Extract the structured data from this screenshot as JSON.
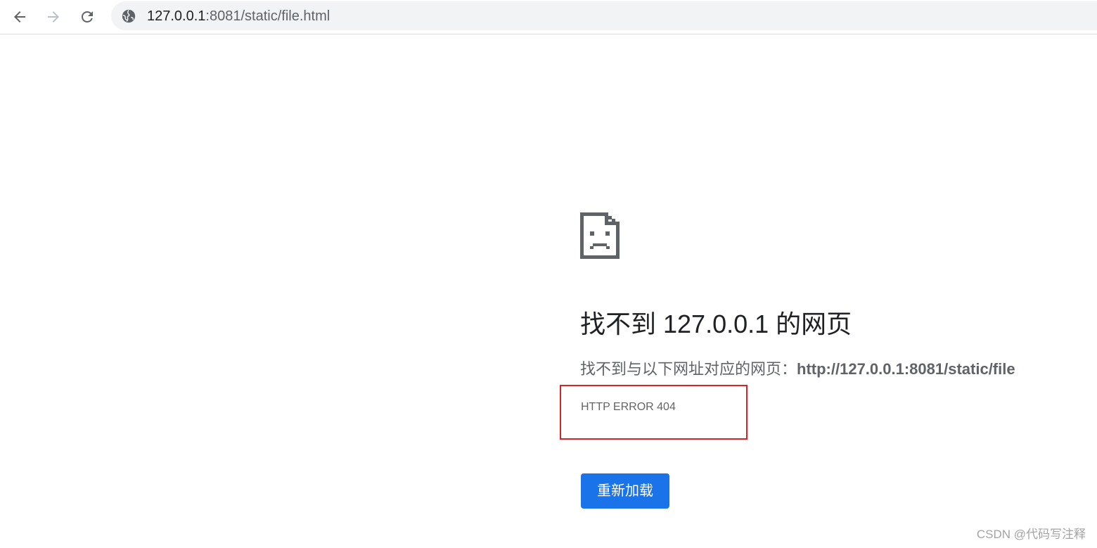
{
  "toolbar": {
    "back_icon": "arrow-left-icon",
    "forward_icon": "arrow-right-icon",
    "reload_icon": "reload-icon",
    "site_info_icon": "globe-icon",
    "url_host": "127.0.0.1",
    "url_rest": ":8081/static/file.html"
  },
  "error_page": {
    "icon": "sad-page-icon",
    "heading": "找不到 127.0.0.1 的网页",
    "description_prefix": "找不到与以下网址对应的网页：",
    "description_url": "http://127.0.0.1:8081/static/file",
    "error_code": "HTTP ERROR 404",
    "reload_label": "重新加载"
  },
  "annotation": {
    "highlight_color": "#d9232a"
  },
  "watermark": "CSDN @代码写注释",
  "colors": {
    "accent": "#1a73e8",
    "text_primary": "#202124",
    "text_secondary": "#5f6368"
  }
}
